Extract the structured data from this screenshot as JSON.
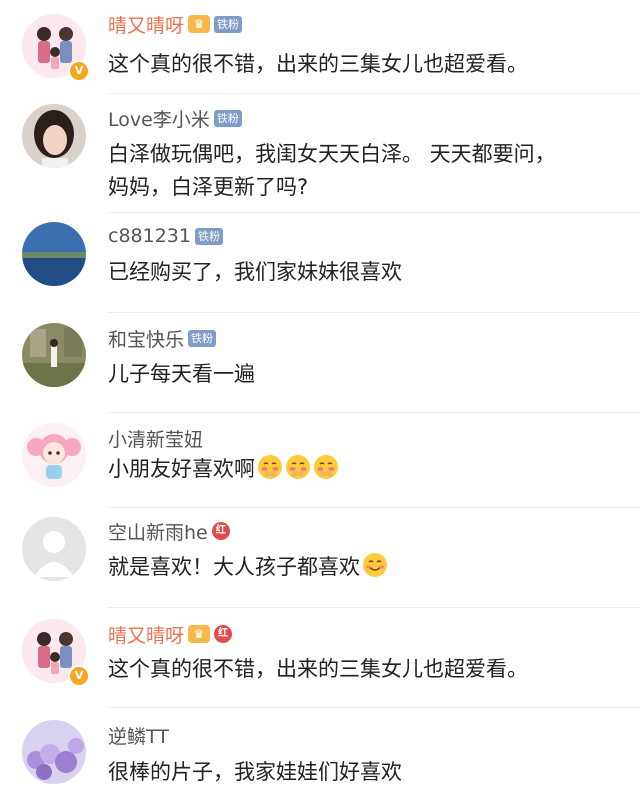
{
  "comments": [
    {
      "name": "晴又晴呀",
      "name_style": "gold",
      "badges": [
        "crown",
        "铁粉"
      ],
      "verified": true,
      "text": "这个真的很不错，出来的三集女儿也超爱看。",
      "avatar": "cartoon-family-avatar"
    },
    {
      "name": "Love李小米",
      "badges": [
        "铁粉"
      ],
      "text_lines": [
        "白泽做玩偶吧，我闺女天天白泽。 天天都要问，",
        "妈妈，白泽更新了吗?"
      ],
      "avatar": "girl-photo-avatar"
    },
    {
      "name": "c881231",
      "badges": [
        "铁粉"
      ],
      "text": "已经购买了，我们家妹妹很喜欢",
      "avatar": "lake-photo-avatar"
    },
    {
      "name": "和宝快乐",
      "badges": [
        "铁粉"
      ],
      "text": "儿子每天看一遍",
      "avatar": "outdoor-photo-avatar"
    },
    {
      "name": "小清新莹妞",
      "badges": [],
      "text": "小朋友好喜欢啊",
      "emojis": [
        "shy-face-icon",
        "shy-face-icon",
        "shy-face-icon"
      ],
      "avatar": "pink-cartoon-girl-avatar"
    },
    {
      "name": "空山新雨he",
      "badges": [
        "红"
      ],
      "text": "就是喜欢！大人孩子都喜欢",
      "emojis": [
        "smile-face-icon"
      ],
      "avatar": "default-person-avatar"
    },
    {
      "name": "晴又晴呀",
      "name_style": "gold",
      "badges": [
        "crown",
        "红"
      ],
      "verified": true,
      "text": "这个真的很不错，出来的三集女儿也超爱看。",
      "avatar": "cartoon-family-avatar"
    },
    {
      "name": "逆鳞TT",
      "badges": [],
      "text": "很棒的片子，我家娃娃们好喜欢",
      "avatar": "purple-flowers-avatar"
    }
  ],
  "badge_labels": {
    "fan": "铁粉",
    "red": "红",
    "crown": "♛",
    "verified": "V"
  },
  "colors": {
    "gold_name": "#eb7350",
    "fan_badge": "#7f9cc9",
    "red_badge": "#e14b4b",
    "crown": "#f7b84b",
    "verified": "#f6a623"
  }
}
